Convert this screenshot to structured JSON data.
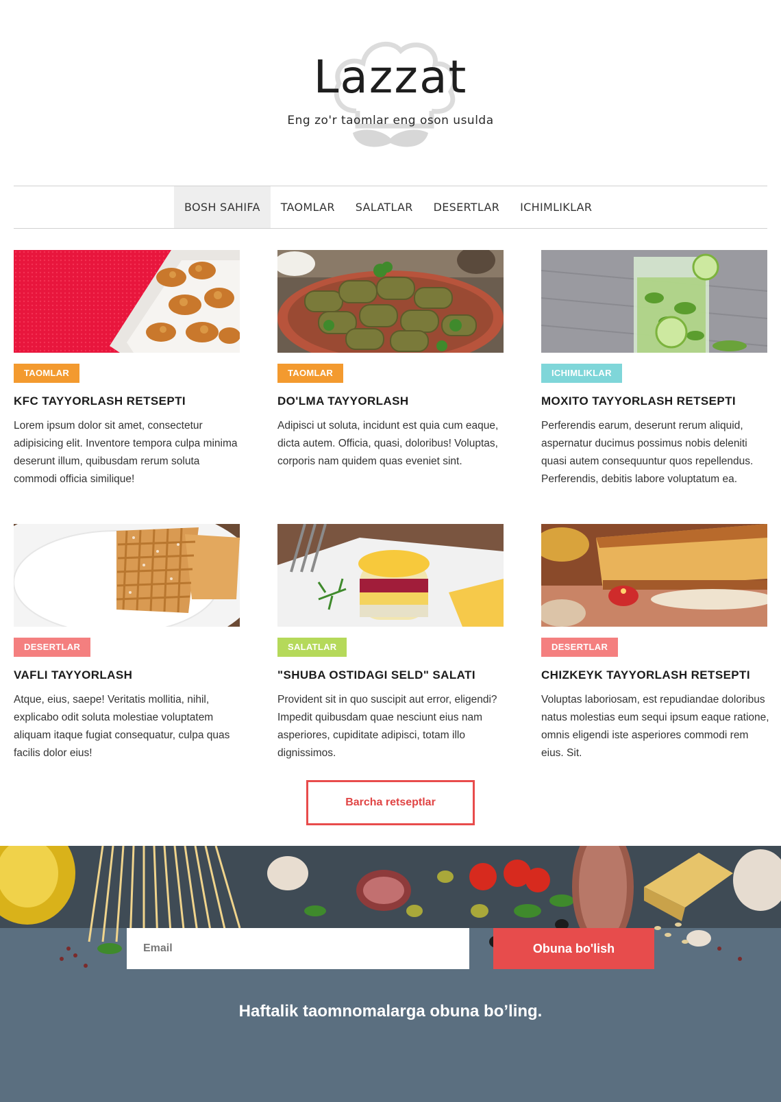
{
  "header": {
    "logo_title": "Lazzat",
    "tagline": "Eng zo'r taomlar eng oson usulda"
  },
  "nav": {
    "items": [
      {
        "label": "BOSH SAHIFA",
        "active": true
      },
      {
        "label": "TAOMLAR",
        "active": false
      },
      {
        "label": "SALATLAR",
        "active": false
      },
      {
        "label": "DESERTLAR",
        "active": false
      },
      {
        "label": "ICHIMLIKLAR",
        "active": false
      }
    ]
  },
  "cards": [
    {
      "category": "TAOMLAR",
      "category_color": "#f39a2f",
      "title": "KFC TAYYORLASH RETSEPTI",
      "text": "Lorem ipsum dolor sit amet, consectetur adipisicing elit. Inventore tempora culpa minima deserunt illum, quibusdam rerum soluta commodi officia similique!"
    },
    {
      "category": "TAOMLAR",
      "category_color": "#f39a2f",
      "title": "DO'LMA TAYYORLASH",
      "text": "Adipisci ut soluta, incidunt est quia cum eaque, dicta autem. Officia, quasi, doloribus! Voluptas, corporis nam quidem quas eveniet sint."
    },
    {
      "category": "ICHIMLIKLAR",
      "category_color": "#7fd6d9",
      "title": "MOXITO TAYYORLASH RETSEPTI",
      "text": "Perferendis earum, deserunt rerum aliquid, aspernatur ducimus possimus nobis deleniti quasi autem consequuntur quos repellendus. Perferendis, debitis labore voluptatum ea."
    },
    {
      "category": "DESERTLAR",
      "category_color": "#f47f7f",
      "title": "VAFLI TAYYORLASH",
      "text": "Atque, eius, saepe! Veritatis mollitia, nihil, explicabo odit soluta molestiae voluptatem aliquam itaque fugiat consequatur, culpa quas facilis dolor eius!"
    },
    {
      "category": "SALATLAR",
      "category_color": "#b5d95a",
      "title": "\"SHUBA OSTIDAGI SELD\" SALATI",
      "text": "Provident sit in quo suscipit aut error, eligendi? Impedit quibusdam quae nesciunt eius nam asperiores, cupiditate adipisci, totam illo dignissimos."
    },
    {
      "category": "DESERTLAR",
      "category_color": "#f47f7f",
      "title": "CHIZKEYK TAYYORLASH RETSEPTI",
      "text": "Voluptas laboriosam, est repudiandae doloribus natus molestias eum sequi ipsum eaque ratione, omnis eligendi iste asperiores commodi rem eius. Sit."
    }
  ],
  "all_recipes_label": "Barcha retseptlar",
  "subscribe": {
    "email_placeholder": "Email",
    "button_label": "Obuna bo'lish",
    "text": "Haftalik taomnomalarga obuna bo’ling."
  },
  "colors": {
    "accent": "#e74c4c",
    "taomlar": "#f39a2f",
    "ichimliklar": "#7fd6d9",
    "desertlar": "#f47f7f",
    "salatlar": "#b5d95a"
  }
}
